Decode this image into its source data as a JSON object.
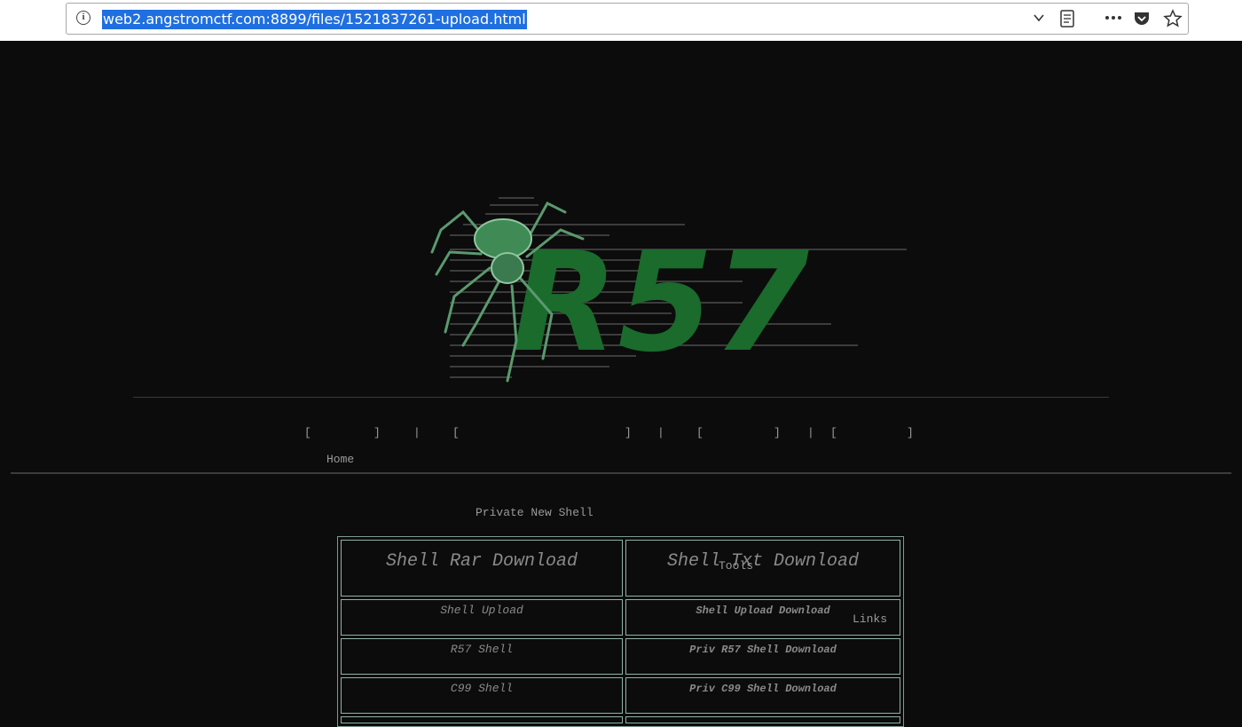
{
  "browser": {
    "url": "web2.angstromctf.com:8899/files/1521837261-upload.html"
  },
  "logo": {
    "text": "R57",
    "brand_color": "#1a6b2c"
  },
  "nav": {
    "items": [
      {
        "label": "Home"
      },
      {
        "label": "Private New Shell"
      },
      {
        "label": "Tools"
      },
      {
        "label": "Links"
      }
    ],
    "separator": "|"
  },
  "downloads": {
    "headers": [
      "Shell Rar Download",
      "Shell Txt Download"
    ],
    "rows": [
      {
        "name": "Shell Upload",
        "link": "Shell Upload Download"
      },
      {
        "name": "R57 Shell",
        "link": "Priv R57 Shell Download"
      },
      {
        "name": "C99 Shell",
        "link": "Priv C99 Shell Download"
      }
    ],
    "link_color": "#c4202a"
  }
}
